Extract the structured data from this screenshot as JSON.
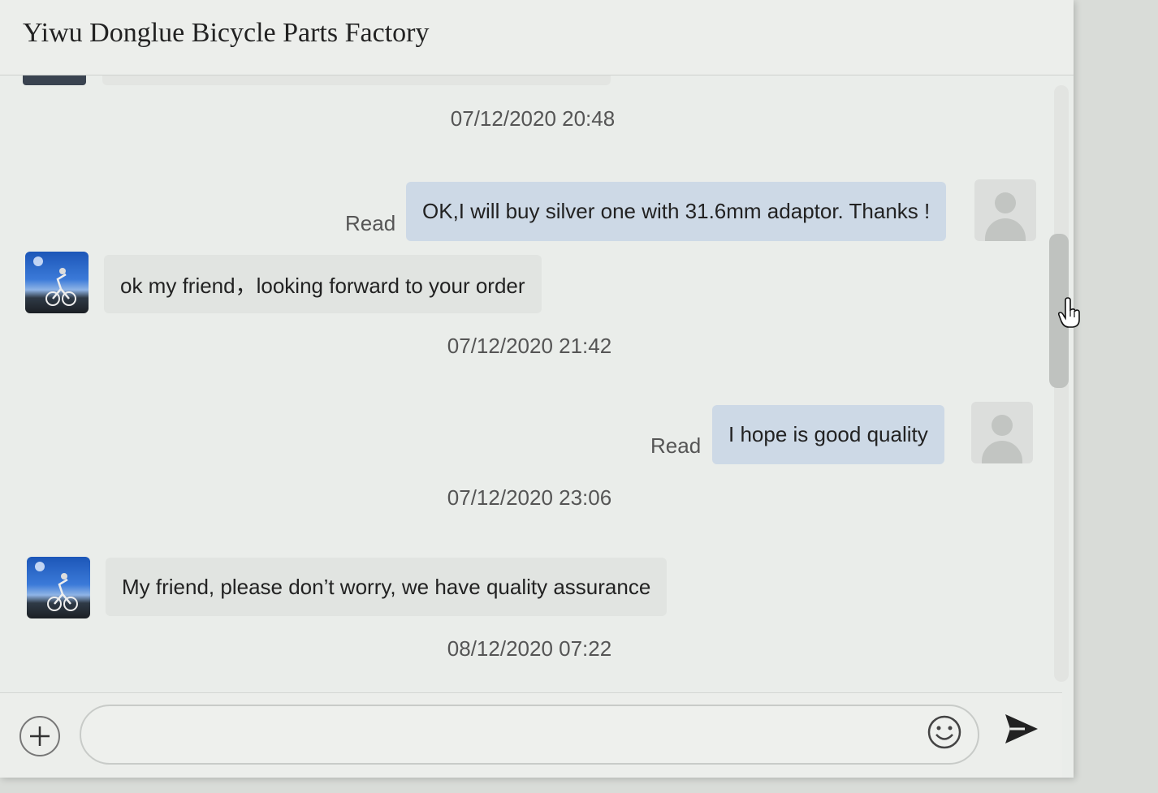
{
  "header": {
    "title": "Yiwu Donglue Bicycle Parts Factory"
  },
  "messages": {
    "ts1": "07/12/2020 20:48",
    "m1": {
      "read": "Read",
      "text": "OK,I will buy silver one with 31.6mm adaptor. Thanks !"
    },
    "m2": {
      "text": "ok my friend，looking forward to your order"
    },
    "ts2": "07/12/2020 21:42",
    "m3": {
      "read": "Read",
      "text": "I hope is good quality"
    },
    "ts3": "07/12/2020 23:06",
    "m4": {
      "text": "My friend, please don’t worry, we have quality assurance"
    },
    "ts4": "08/12/2020 07:22"
  },
  "input": {
    "placeholder": "",
    "value": ""
  },
  "icons": {
    "add": "plus-icon",
    "emoji": "smiley-icon",
    "send": "send-arrow-icon",
    "cursor": "hand-pointer-icon"
  },
  "colors": {
    "outgoing_bubble": "#cdd9e6",
    "incoming_bubble": "#e1e4e1",
    "background": "#eaedea"
  }
}
